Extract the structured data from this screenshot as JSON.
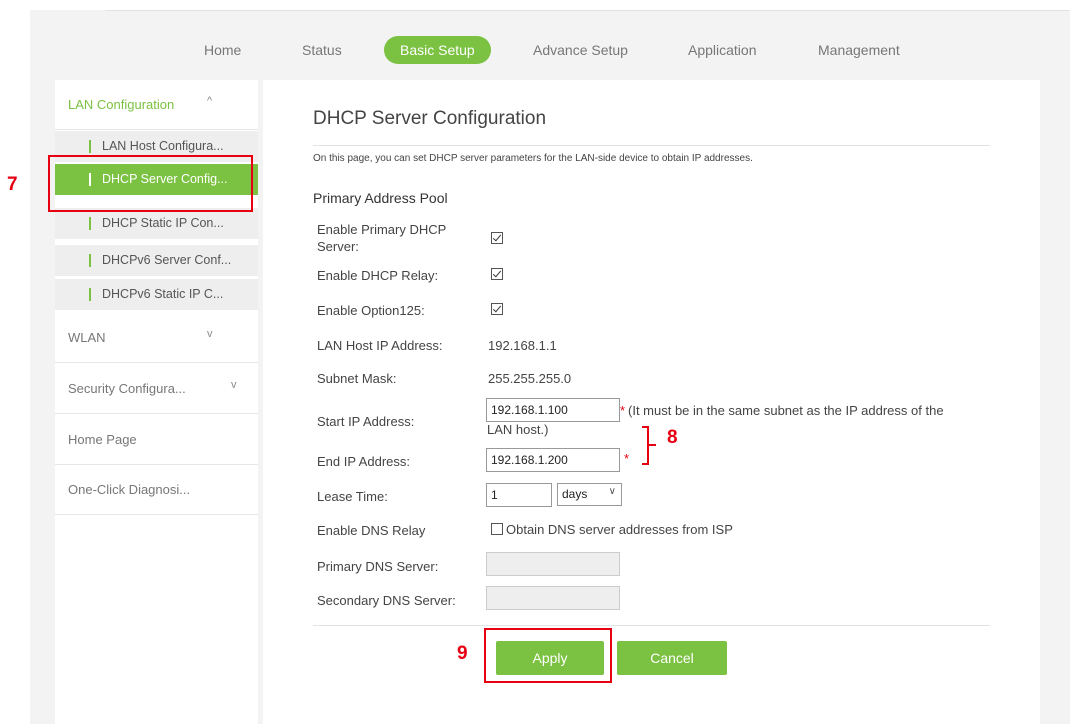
{
  "nav": {
    "items": [
      "Home",
      "Status",
      "Basic Setup",
      "Advance Setup",
      "Application",
      "Management"
    ],
    "active": "Basic Setup"
  },
  "sidebar": {
    "groups": [
      {
        "label": "LAN Configuration",
        "chevron": "^"
      },
      {
        "label": "WLAN",
        "chevron": "v"
      },
      {
        "label": "Security Configura...",
        "chevron": "v"
      },
      {
        "label": "Home Page"
      },
      {
        "label": "One-Click Diagnosi..."
      }
    ],
    "subitems": [
      "LAN Host Configura...",
      "DHCP Server Config...",
      "DHCP Static IP Con...",
      "DHCPv6 Server Conf...",
      "DHCPv6 Static IP C..."
    ],
    "active_subitem": "DHCP Server Config..."
  },
  "main": {
    "title": "DHCP Server Configuration",
    "description": "On this page, you can set DHCP server parameters for the LAN-side device to obtain IP addresses.",
    "section": "Primary Address Pool",
    "fields": {
      "enable_primary_dhcp": {
        "label": "Enable Primary DHCP Server:",
        "checked": true
      },
      "enable_dhcp_relay": {
        "label": "Enable DHCP Relay:",
        "checked": true
      },
      "enable_option125": {
        "label": "Enable Option125:",
        "checked": true
      },
      "lan_host_ip": {
        "label": "LAN Host IP Address:",
        "value": "192.168.1.1"
      },
      "subnet_mask": {
        "label": "Subnet Mask:",
        "value": "255.255.255.0"
      },
      "start_ip": {
        "label": "Start IP Address:",
        "value": "192.168.1.100"
      },
      "end_ip": {
        "label": "End IP Address:",
        "value": "192.168.1.200"
      },
      "lease_time": {
        "label": "Lease Time:",
        "value": "1",
        "unit": "days"
      },
      "dns_relay": {
        "label": "Enable DNS Relay",
        "option": "Obtain DNS server addresses from ISP",
        "checked": false
      },
      "primary_dns": {
        "label": "Primary DNS Server:",
        "value": ""
      },
      "secondary_dns": {
        "label": "Secondary DNS Server:",
        "value": ""
      }
    },
    "start_ip_note_star": "*",
    "start_ip_note": "(It must be in the same subnet as the IP address of the LAN host.)",
    "end_ip_star": "*",
    "buttons": {
      "apply": "Apply",
      "cancel": "Cancel"
    }
  },
  "annotations": {
    "step7": "7",
    "step8": "8",
    "step9": "9"
  },
  "colors": {
    "accent": "#7bc142",
    "annotation": "#e60012"
  }
}
